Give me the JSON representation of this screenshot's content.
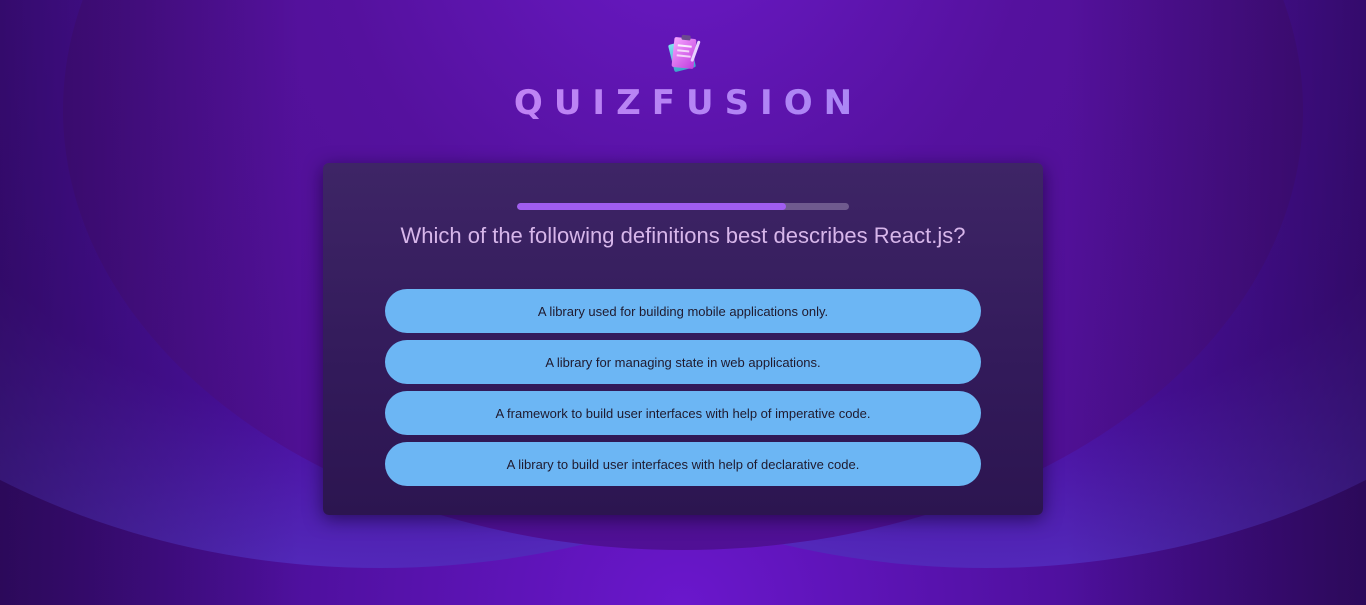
{
  "app": {
    "brand": "QUIZFUSION",
    "logo_icon": "quiz-logo-icon"
  },
  "quiz": {
    "progress_fraction": 0.81,
    "question": "Which of the following definitions best describes React.js?",
    "answers": [
      "A library used for building mobile applications only.",
      "A library for managing state in web applications.",
      "A framework to build user interfaces with help of imperative code.",
      "A library to build user interfaces with help of declarative code."
    ]
  },
  "colors": {
    "background": "#4b0f98",
    "card": "#3a2262",
    "progress_fill": "#a05df0",
    "progress_track": "#6f5a8e",
    "answer_button": "#6cb6f4",
    "question_text": "#d7b6ea",
    "brand_gradient_start": "#e07ff0",
    "brand_gradient_end": "#8f96f7"
  }
}
